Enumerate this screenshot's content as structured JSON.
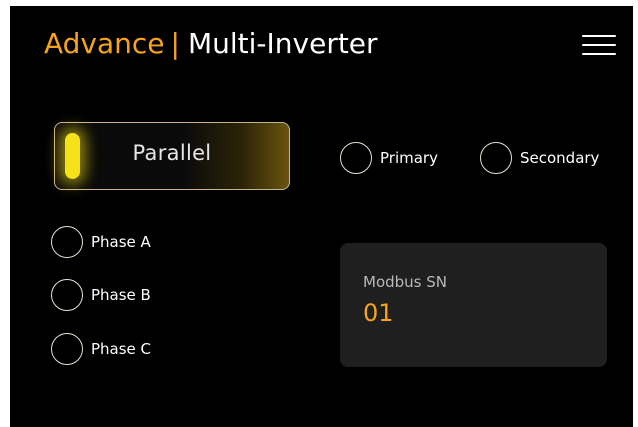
{
  "header": {
    "section": "Advance",
    "separator": "|",
    "title": "Multi-Inverter",
    "menu_icon": "hamburger-menu-icon"
  },
  "mode": {
    "label": "Parallel",
    "state": "on",
    "indicator_color": "#f7e21a"
  },
  "role": {
    "options": [
      {
        "label": "Primary",
        "selected": false
      },
      {
        "label": "Secondary",
        "selected": false
      }
    ]
  },
  "phase": {
    "options": [
      {
        "label": "Phase A",
        "selected": false
      },
      {
        "label": "Phase B",
        "selected": false
      },
      {
        "label": "Phase C",
        "selected": false
      }
    ]
  },
  "modbus": {
    "label": "Modbus SN",
    "value": "01"
  },
  "colors": {
    "accent": "#f7a41d",
    "background": "#000000",
    "card": "#1f1f1f",
    "text": "#ffffff"
  }
}
